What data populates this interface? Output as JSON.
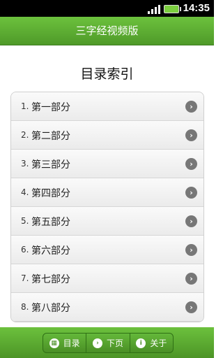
{
  "status_bar": {
    "time": "14:35"
  },
  "app_title": "三字经视频版",
  "page_heading": "目录索引",
  "items": [
    {
      "num": "1.",
      "label": "第一部分"
    },
    {
      "num": "2.",
      "label": "第二部分"
    },
    {
      "num": "3.",
      "label": "第三部分"
    },
    {
      "num": "4.",
      "label": "第四部分"
    },
    {
      "num": "5.",
      "label": "第五部分"
    },
    {
      "num": "6.",
      "label": "第六部分"
    },
    {
      "num": "7.",
      "label": "第七部分"
    },
    {
      "num": "8.",
      "label": "第八部分"
    }
  ],
  "footer_nav": [
    {
      "label": "目录",
      "icon": "grid-icon"
    },
    {
      "label": "下页",
      "icon": "chevron-right-icon"
    },
    {
      "label": "关于",
      "icon": "info-icon"
    }
  ]
}
